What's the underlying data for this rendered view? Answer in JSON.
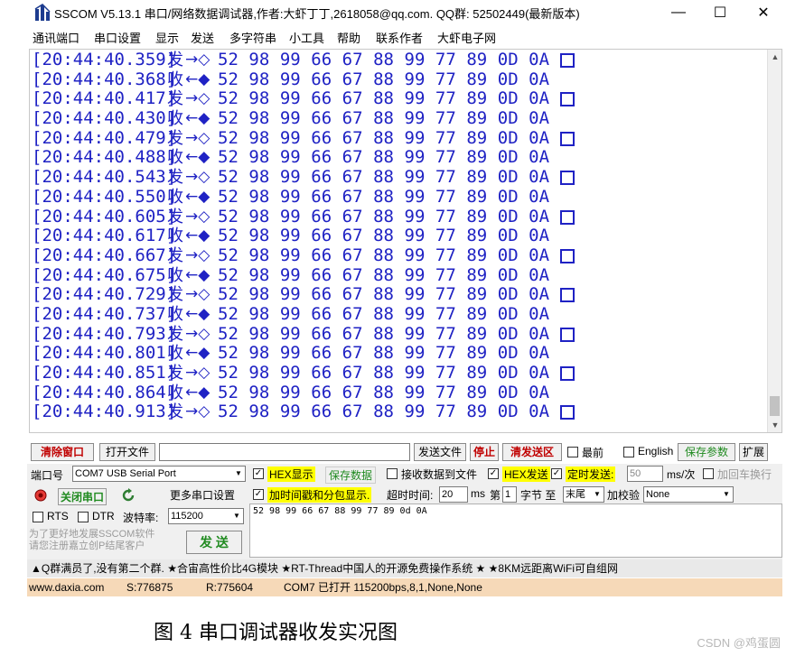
{
  "window": {
    "title": "SSCOM V5.13.1 串口/网络数据调试器,作者:大虾丁丁,2618058@qq.com. QQ群: 52502449(最新版本)",
    "controls": {
      "minimize": "—",
      "maximize": "☐",
      "close": "✕"
    }
  },
  "menu": [
    "通讯端口",
    "串口设置",
    "显示",
    "发送",
    "多字符串",
    "小工具",
    "帮助",
    "联系作者",
    "大虾电子网"
  ],
  "log": {
    "rows": [
      {
        "ts": "[20:44:40.359]",
        "dir": "发",
        "arrow": "→◇",
        "bytes": "52 98 99 66 67 88 99 77 89 0D 0A",
        "box": true
      },
      {
        "ts": "[20:44:40.368]",
        "dir": "收",
        "arrow": "←◆",
        "bytes": "52 98 99 66 67 88 99 77 89 0D 0A",
        "box": false
      },
      {
        "ts": "[20:44:40.417]",
        "dir": "发",
        "arrow": "→◇",
        "bytes": "52 98 99 66 67 88 99 77 89 0D 0A",
        "box": true
      },
      {
        "ts": "[20:44:40.430]",
        "dir": "收",
        "arrow": "←◆",
        "bytes": "52 98 99 66 67 88 99 77 89 0D 0A",
        "box": false
      },
      {
        "ts": "[20:44:40.479]",
        "dir": "发",
        "arrow": "→◇",
        "bytes": "52 98 99 66 67 88 99 77 89 0D 0A",
        "box": true
      },
      {
        "ts": "[20:44:40.488]",
        "dir": "收",
        "arrow": "←◆",
        "bytes": "52 98 99 66 67 88 99 77 89 0D 0A",
        "box": false
      },
      {
        "ts": "[20:44:40.543]",
        "dir": "发",
        "arrow": "→◇",
        "bytes": "52 98 99 66 67 88 99 77 89 0D 0A",
        "box": true
      },
      {
        "ts": "[20:44:40.550]",
        "dir": "收",
        "arrow": "←◆",
        "bytes": "52 98 99 66 67 88 99 77 89 0D 0A",
        "box": false
      },
      {
        "ts": "[20:44:40.605]",
        "dir": "发",
        "arrow": "→◇",
        "bytes": "52 98 99 66 67 88 99 77 89 0D 0A",
        "box": true
      },
      {
        "ts": "[20:44:40.617]",
        "dir": "收",
        "arrow": "←◆",
        "bytes": "52 98 99 66 67 88 99 77 89 0D 0A",
        "box": false
      },
      {
        "ts": "[20:44:40.667]",
        "dir": "发",
        "arrow": "→◇",
        "bytes": "52 98 99 66 67 88 99 77 89 0D 0A",
        "box": true
      },
      {
        "ts": "[20:44:40.675]",
        "dir": "收",
        "arrow": "←◆",
        "bytes": "52 98 99 66 67 88 99 77 89 0D 0A",
        "box": false
      },
      {
        "ts": "[20:44:40.729]",
        "dir": "发",
        "arrow": "→◇",
        "bytes": "52 98 99 66 67 88 99 77 89 0D 0A",
        "box": true
      },
      {
        "ts": "[20:44:40.737]",
        "dir": "收",
        "arrow": "←◆",
        "bytes": "52 98 99 66 67 88 99 77 89 0D 0A",
        "box": false
      },
      {
        "ts": "[20:44:40.793]",
        "dir": "发",
        "arrow": "→◇",
        "bytes": "52 98 99 66 67 88 99 77 89 0D 0A",
        "box": true
      },
      {
        "ts": "[20:44:40.801]",
        "dir": "收",
        "arrow": "←◆",
        "bytes": "52 98 99 66 67 88 99 77 89 0D 0A",
        "box": false
      },
      {
        "ts": "[20:44:40.851]",
        "dir": "发",
        "arrow": "→◇",
        "bytes": "52 98 99 66 67 88 99 77 89 0D 0A",
        "box": true
      },
      {
        "ts": "[20:44:40.864]",
        "dir": "收",
        "arrow": "←◆",
        "bytes": "52 98 99 66 67 88 99 77 89 0D 0A",
        "box": false
      },
      {
        "ts": "[20:44:40.913]",
        "dir": "发",
        "arrow": "→◇",
        "bytes": "52 98 99 66 67 88 99 77 89 0D 0A",
        "box": true
      }
    ],
    "text_color": "#1f22c4"
  },
  "toolbar": {
    "clear_window": "清除窗口",
    "open_file": "打开文件",
    "send_file": "发送文件",
    "stop": "停止",
    "clear_send": "清发送区",
    "topmost": "最前",
    "english": "English",
    "save_params": "保存参数",
    "expand": "扩展"
  },
  "settings": {
    "port_label": "端口号",
    "port_value": "COM7 USB Serial Port",
    "hex_display": "HEX显示",
    "save_data": "保存数据",
    "recv_to_file": "接收数据到文件",
    "hex_send": "HEX发送",
    "timed_send": "定时发送:",
    "timed_value": "50",
    "timed_unit": "ms/次",
    "add_crlf": "加回车换行",
    "close_port": "关闭串口",
    "more_settings": "更多串口设置",
    "timestamp_split": "加时间戳和分包显示.",
    "timeout_label": "超时时间:",
    "timeout_value": "20",
    "timeout_unit": "ms",
    "byte_prefix": "第",
    "byte_value": "1",
    "byte_label": "字节 至",
    "byte_end": "末尾",
    "checksum_label": "加校验",
    "checksum_value": "None",
    "rts": "RTS",
    "dtr": "DTR",
    "baud_label": "波特率:",
    "baud_value": "115200",
    "promo": "为了更好地发展SSCOM软件\n请您注册嘉立创P结尾客户",
    "send_button": "发 送",
    "send_text": "52 98 99 66 67 88 99 77 89 0d 0A"
  },
  "marquee": "▲Q群满员了,没有第二个群. ★合宙高性价比4G模块 ★RT-Thread中国人的开源免费操作系统 ★ ★8KM远距离WiFi可自组网",
  "status": {
    "site": "www.daxia.com",
    "sent": "S:776875",
    "recv": "R:775604",
    "port_status": "COM7 已打开  115200bps,8,1,None,None"
  },
  "caption": "图 4      串口调试器收发实况图",
  "watermark": "CSDN @鸡蛋圆",
  "colors": {
    "status_bg": "#f6d9b8",
    "highlight": "#ffff00",
    "alert_red": "#c00000",
    "green": "#1f8a1f"
  }
}
